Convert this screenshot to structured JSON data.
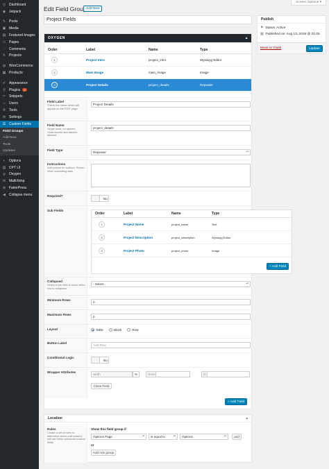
{
  "sidebar": {
    "items": [
      {
        "label": "Dashboard",
        "icon": "dashboard-icon",
        "glyph": "◴"
      },
      {
        "label": "Jetpack",
        "icon": "jetpack-icon",
        "glyph": "◉"
      },
      {
        "label": "Posts",
        "icon": "pin-icon",
        "glyph": "✎"
      },
      {
        "label": "Media",
        "icon": "media-icon",
        "glyph": "▣"
      },
      {
        "label": "Featured Images",
        "icon": "image-icon",
        "glyph": "▤"
      },
      {
        "label": "Pages",
        "icon": "pages-icon",
        "glyph": "▭"
      },
      {
        "label": "Comments",
        "icon": "comments-icon",
        "glyph": "◌"
      },
      {
        "label": "Projects",
        "icon": "projects-icon",
        "glyph": "✎"
      },
      {
        "label": "WooCommerce",
        "icon": "woo-icon",
        "glyph": "◍"
      },
      {
        "label": "Products",
        "icon": "products-icon",
        "glyph": "▦"
      },
      {
        "label": "Appearance",
        "icon": "brush-icon",
        "glyph": "✐"
      },
      {
        "label": "Plugins",
        "icon": "plugin-icon",
        "glyph": "⚲",
        "badge": "2"
      },
      {
        "label": "Snippets",
        "icon": "snippets-icon",
        "glyph": "✂"
      },
      {
        "label": "Users",
        "icon": "users-icon",
        "glyph": "☺"
      },
      {
        "label": "Tools",
        "icon": "tools-icon",
        "glyph": "✇"
      },
      {
        "label": "Settings",
        "icon": "settings-icon",
        "glyph": "⚙"
      },
      {
        "label": "Custom Fields",
        "icon": "custom-fields-icon",
        "glyph": "☰"
      }
    ],
    "submenu": [
      "Field Groups",
      "Add New",
      "Tools",
      "Updates"
    ],
    "bottom": [
      {
        "label": "Options",
        "icon": "options-icon",
        "glyph": "◐"
      },
      {
        "label": "CPT UI",
        "icon": "cptui-icon",
        "glyph": "▥"
      },
      {
        "label": "Oxygen",
        "icon": "oxygen-icon",
        "glyph": "◎"
      },
      {
        "label": "Mailchimp",
        "icon": "mailchimp-icon",
        "glyph": "✉"
      },
      {
        "label": "FakerPress",
        "icon": "fakerpress-icon",
        "glyph": "⊕"
      },
      {
        "label": "Collapse menu",
        "icon": "collapse-icon",
        "glyph": "◀"
      }
    ]
  },
  "header": {
    "screen_options": "Screen Options ▾",
    "title": "Edit Field Group",
    "add_new": "Add New",
    "group_title": "Project Fields"
  },
  "publish": {
    "heading": "Publish",
    "status": "Status: Active",
    "published": "Published on: Aug 13, 2019 @ 01:05",
    "trash": "Move to Trash",
    "update": "Update"
  },
  "group": {
    "heading": "OXYGEN",
    "columns": [
      "Order",
      "Label",
      "Name",
      "Type"
    ],
    "fields": [
      {
        "order": "1",
        "label": "Project Intro",
        "name": "project_intro",
        "type": "Wysiwyg Editor"
      },
      {
        "order": "2",
        "label": "Main Image",
        "name": "main_image",
        "type": "Image"
      },
      {
        "order": "3",
        "label": "Project Details",
        "name": "project_details",
        "type": "Repeater"
      }
    ]
  },
  "settings": {
    "field_label": {
      "label": "Field Label",
      "desc": "This is the name which will appear on the EDIT page",
      "value": "Project Details"
    },
    "field_name": {
      "label": "Field Name",
      "desc": "Single word, no spaces. Underscores and dashes allowed",
      "value": "project_details"
    },
    "field_type": {
      "label": "Field Type",
      "value": "Repeater"
    },
    "instructions": {
      "label": "Instructions",
      "desc": "Instructions for authors. Shown when submitting data"
    },
    "required": {
      "label": "Required?",
      "value": "No"
    },
    "sub_fields": {
      "label": "Sub Fields",
      "columns": [
        "Order",
        "Label",
        "Name",
        "Type"
      ],
      "rows": [
        {
          "order": "1",
          "label": "Project Name",
          "name": "project_name",
          "type": "Text"
        },
        {
          "order": "2",
          "label": "Project Description",
          "name": "project_description",
          "type": "Wysiwyg Editor"
        },
        {
          "order": "3",
          "label": "Project Photo",
          "name": "project_photo",
          "type": "Image"
        }
      ],
      "add_button": "+ Add Field"
    },
    "collapsed": {
      "label": "Collapsed",
      "desc": "Select a sub field to show when row is collapsed",
      "value": "- Select -"
    },
    "min_rows": {
      "label": "Minimum Rows",
      "value": "0"
    },
    "max_rows": {
      "label": "Maximum Rows",
      "value": "0"
    },
    "layout": {
      "label": "Layout",
      "options": [
        "Table",
        "Block",
        "Row"
      ],
      "selected": "Table"
    },
    "button_label": {
      "label": "Button Label",
      "placeholder": "Add Row"
    },
    "conditional": {
      "label": "Conditional Logic",
      "value": "No"
    },
    "wrapper": {
      "label": "Wrapper Attributes",
      "width": "width",
      "percent": "%",
      "class": "class",
      "id": "id"
    },
    "close_field": "Close Field",
    "add_field": "+ Add Field"
  },
  "location": {
    "heading": "Location",
    "rules_label": "Rules",
    "rules_desc": "Create a set of rules to determine which edit screens will use these advanced custom fields",
    "show_if": "Show this field group if",
    "param": "Options Page",
    "operator": "is equal to",
    "value": "Options",
    "and": "and",
    "or": "or",
    "add_rule_group": "Add rule group"
  }
}
